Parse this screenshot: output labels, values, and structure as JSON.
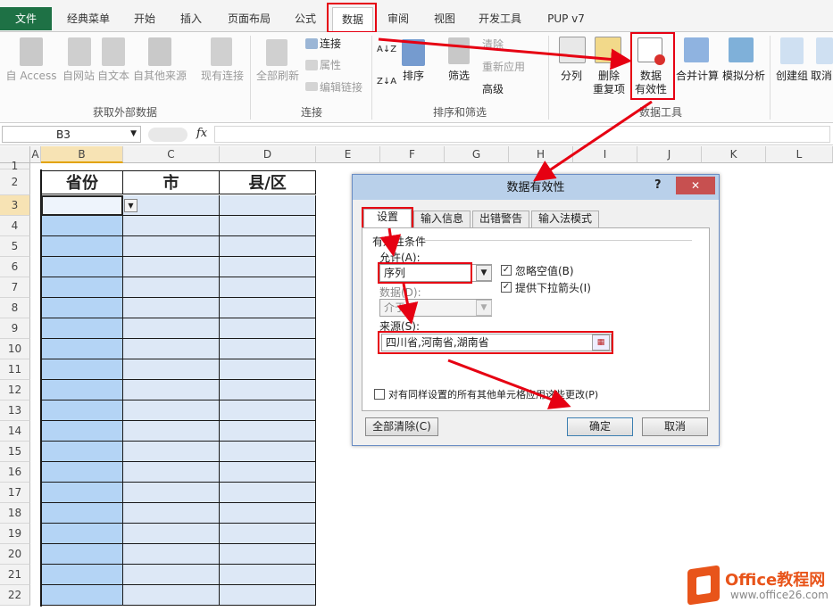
{
  "tabs": {
    "file": "文件",
    "classic": "经典菜单",
    "home": "开始",
    "insert": "插入",
    "layout": "页面布局",
    "formula": "公式",
    "data": "数据",
    "review": "审阅",
    "view": "视图",
    "developer": "开发工具",
    "pup": "PUP v7"
  },
  "ribbon": {
    "access": "自 Access",
    "web": "自网站",
    "text": "自文本",
    "other1": "自其他来源",
    "existing": "现有连接",
    "refresh": "全部刷新",
    "connect": "连接",
    "props": "属性",
    "editlinks": "编辑链接",
    "sort_asc": "A↓Z",
    "sort": "排序",
    "filter": "筛选",
    "clear": "清除",
    "reapply": "重新应用",
    "advanced": "高级",
    "split": "分列",
    "remove1": "删除",
    "remove2": "重复项",
    "validate1": "数据",
    "validate2": "有效性",
    "consolidate": "合并计算",
    "whatif": "模拟分析",
    "group": "创建组",
    "ungroup": "取消",
    "g_external": "获取外部数据",
    "g_connect": "连接",
    "g_sort": "排序和筛选",
    "g_tools": "数据工具"
  },
  "formulabar": {
    "namebox": "B3",
    "fx": "fx"
  },
  "grid": {
    "columns": [
      "A",
      "B",
      "C",
      "D",
      "E",
      "F",
      "G",
      "H",
      "I",
      "J",
      "K",
      "L"
    ],
    "rows": [
      "1",
      "2",
      "3",
      "4",
      "5",
      "6",
      "7",
      "8",
      "9",
      "10",
      "11",
      "12",
      "13",
      "14",
      "15",
      "16",
      "17",
      "18",
      "19",
      "20",
      "21",
      "22"
    ],
    "header_province": "省份",
    "header_city": "市",
    "header_county": "县/区"
  },
  "dialog": {
    "title": "数据有效性",
    "help": "?",
    "close": "✕",
    "tab_settings": "设置",
    "tab_input": "输入信息",
    "tab_error": "出错警告",
    "tab_ime": "输入法模式",
    "criteria": "有效性条件",
    "allow_label": "允许(A):",
    "allow_value": "序列",
    "ignore_blank": "忽略空值(B)",
    "dropdown": "提供下拉箭头(I)",
    "data_label": "数据(D):",
    "data_value": "介于",
    "source_label": "来源(S):",
    "source_value": "四川省,河南省,湖南省",
    "apply_all": "对有同样设置的所有其他单元格应用这些更改(P)",
    "clear_all": "全部清除(C)",
    "ok": "确定",
    "cancel": "取消"
  },
  "watermark": {
    "brand": "Office教程网",
    "url": "www.office26.com"
  },
  "colors": {
    "accent_red": "#e60012",
    "excel_green": "#1e7145",
    "selection_blue": "#b4d4f5",
    "cell_blue": "#dde8f6",
    "office_orange": "#e8541a"
  }
}
